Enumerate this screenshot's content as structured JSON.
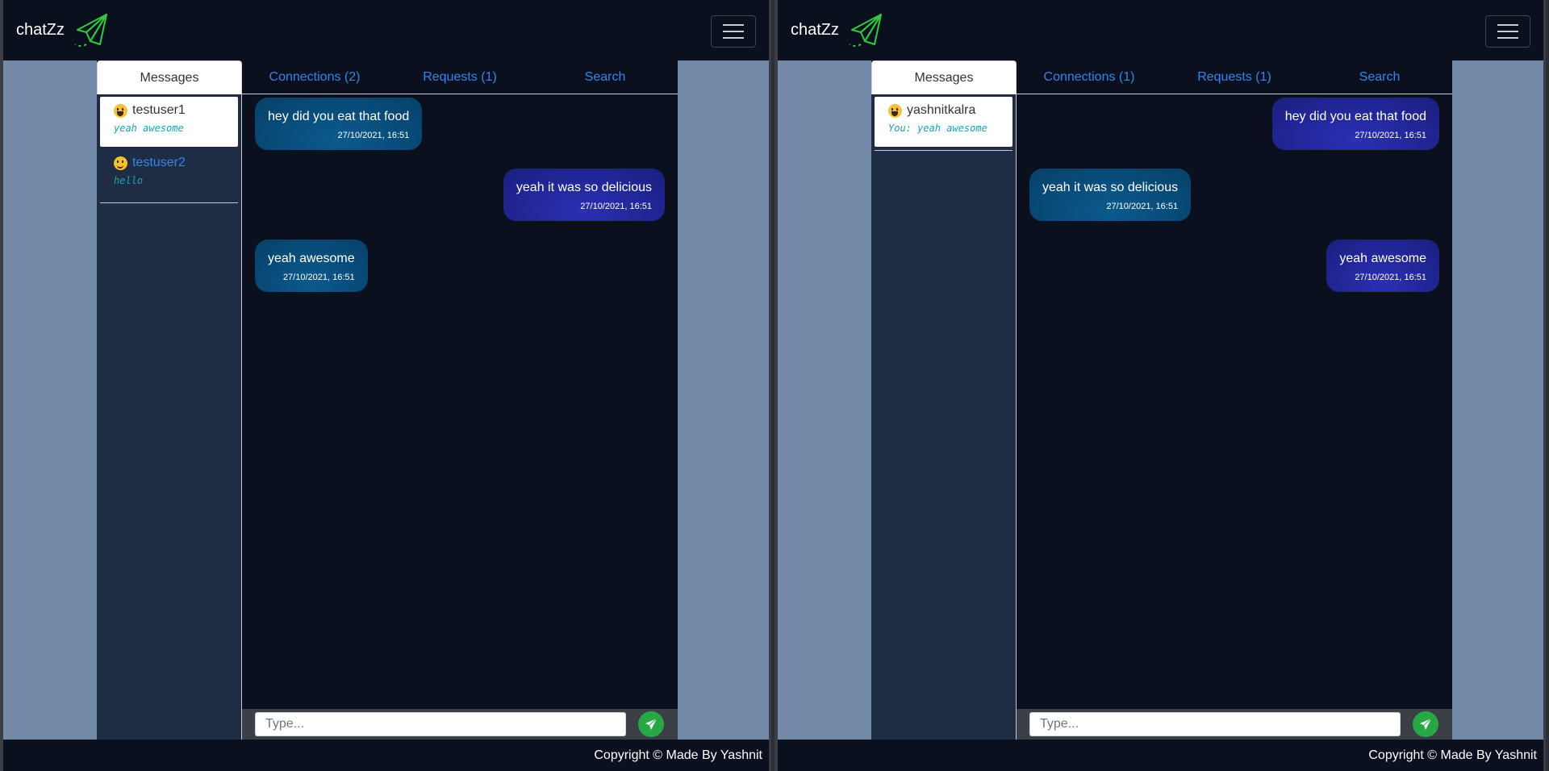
{
  "panes": [
    {
      "navbar": {
        "brand": "chatZz"
      },
      "tabs": {
        "messages": "Messages",
        "connections": "Connections (2)",
        "requests": "Requests (1)",
        "search": "Search"
      },
      "contacts": [
        {
          "name": "testuser1",
          "preview": "yeah awesome",
          "icon": "grinning-face-icon"
        },
        {
          "name": "testuser2",
          "preview": "hello",
          "icon": "smiling-face-icon"
        }
      ],
      "messages": [
        {
          "direction": "in",
          "text": "hey did you eat that food",
          "time": "27/10/2021, 16:51"
        },
        {
          "direction": "out",
          "text": "yeah it was so delicious",
          "time": "27/10/2021, 16:51"
        },
        {
          "direction": "in",
          "text": "yeah awesome",
          "time": "27/10/2021, 16:51"
        }
      ],
      "input": {
        "placeholder": "Type..."
      },
      "footer": "Copyright © Made By Yashnit"
    },
    {
      "navbar": {
        "brand": "chatZz"
      },
      "tabs": {
        "messages": "Messages",
        "connections": "Connections (1)",
        "requests": "Requests (1)",
        "search": "Search"
      },
      "contacts": [
        {
          "name": "yashnitkalra",
          "preview": "You: yeah awesome",
          "icon": "grinning-face-icon"
        }
      ],
      "messages": [
        {
          "direction": "out",
          "text": "hey did you eat that food",
          "time": "27/10/2021, 16:51"
        },
        {
          "direction": "in",
          "text": "yeah it was so delicious",
          "time": "27/10/2021, 16:51"
        },
        {
          "direction": "out",
          "text": "yeah awesome",
          "time": "27/10/2021, 16:51"
        }
      ],
      "input": {
        "placeholder": "Type..."
      },
      "footer": "Copyright © Made By Yashnit"
    }
  ],
  "colors": {
    "navbar_bg": "#0b101e",
    "page_bg": "#738aa8",
    "link_blue": "#2f86f0",
    "preview_teal": "#17a2b8",
    "incoming_bubble": "#064068",
    "outgoing_bubble": "#1a1f7e",
    "send_green": "#27a844"
  }
}
